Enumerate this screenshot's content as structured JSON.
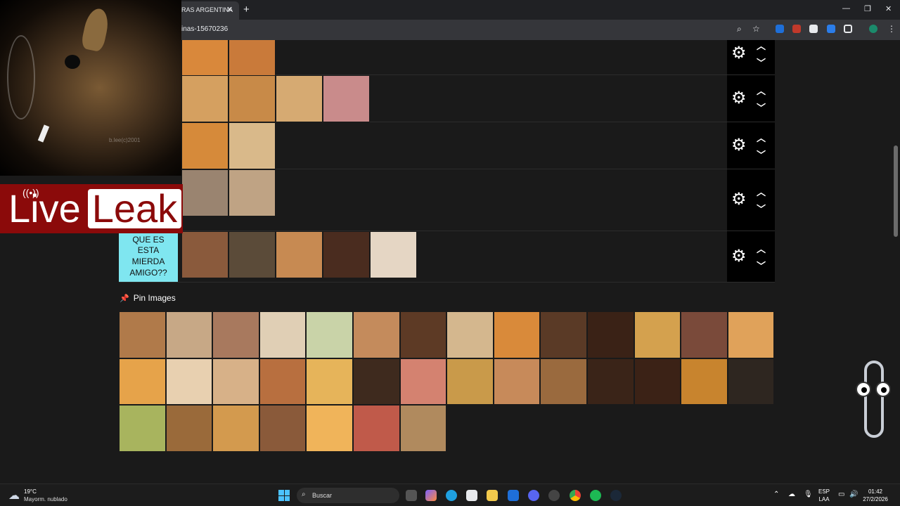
{
  "browser": {
    "tab_title": "RAS ARGENTINA",
    "tab_close": "✕",
    "new_tab": "+",
    "url": "inas-15670236",
    "window_controls": [
      "—",
      "❐",
      "✕"
    ]
  },
  "tiers": [
    {
      "label": "",
      "color": "",
      "tiles": [
        "#d9883b",
        "#c97a3a"
      ]
    },
    {
      "label": "",
      "color": "",
      "tiles": [
        "#d5a060",
        "#c88a48",
        "#d6aa72",
        "#c98b8b"
      ]
    },
    {
      "label": "",
      "color": "",
      "tiles": [
        "#d68a3a",
        "#d9b98a"
      ]
    },
    {
      "label": "",
      "color": "",
      "tiles": [
        "#9a8470",
        "#bfa384"
      ]
    },
    {
      "label": "QUE ES ESTA MIERDA AMIGO??",
      "color": "#7fe6f0",
      "tiles": [
        "#8a5a3c",
        "#5b4b39",
        "#c78a52",
        "#4a2c1f",
        "#e5d6c4"
      ]
    }
  ],
  "pin_section": {
    "title": "Pin Images",
    "tiles": [
      "#b07a4a",
      "#c7a886",
      "#a8795e",
      "#e0cfb5",
      "#c9d3a8",
      "#c48b5c",
      "#5d3a25",
      "#d4b78e",
      "#d98a3a",
      "#5a3a26",
      "#3a2216",
      "#d4a14e",
      "#7a4a3a",
      "#e0a25a",
      "#e6a34a",
      "#e8d0b0",
      "#d7b188",
      "#b86f3f",
      "#e6b45a",
      "#3e2a1e",
      "#d48270",
      "#c99a4a",
      "#c78a5a",
      "#9a6a3e",
      "#3a2418",
      "#3b2216",
      "#c8842e",
      "#2e2620",
      "#a8b45e",
      "#9a6a3a",
      "#d39a4e",
      "#8a5a3a",
      "#f0b45a",
      "#c05a4a",
      "#b08a5e"
    ]
  },
  "overlay": {
    "watermark": "b.lee(c)2001",
    "liveleak_live": "Live",
    "liveleak_leak": "Leak"
  },
  "taskbar": {
    "temp": "19°C",
    "weather": "Mayorm. nublado",
    "search": "Buscar",
    "lang_top": "ESP",
    "lang_bottom": "LAA",
    "time": "01:42",
    "date": "27/2/2026"
  }
}
